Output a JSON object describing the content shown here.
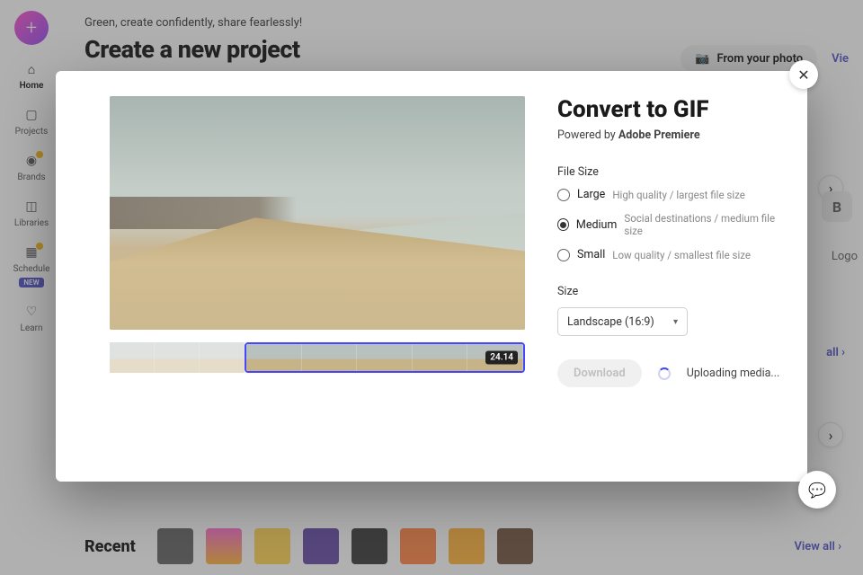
{
  "page": {
    "greeting": "Green, create confidently, share fearlessly!",
    "heading": "Create a new project",
    "from_photo": "From your photo",
    "view_link": "Vie",
    "logo_label": "Logo",
    "viewall": "all  ›",
    "recent_label": "Recent",
    "viewall_full": "View all  ›"
  },
  "sidebar": {
    "items": [
      {
        "label": "Home"
      },
      {
        "label": "Projects"
      },
      {
        "label": "Brands"
      },
      {
        "label": "Libraries"
      },
      {
        "label": "Schedule"
      },
      {
        "label": "Learn"
      }
    ],
    "new_badge": "NEW"
  },
  "modal": {
    "title": "Convert to GIF",
    "powered_prefix": "Powered by ",
    "powered_brand": "Adobe Premiere",
    "filesize_label": "File Size",
    "options": [
      {
        "name": "Large",
        "desc": "High quality / largest file size",
        "selected": false
      },
      {
        "name": "Medium",
        "desc": "Social destinations / medium file size",
        "selected": true
      },
      {
        "name": "Small",
        "desc": "Low quality / smallest file size",
        "selected": false
      }
    ],
    "size_label": "Size",
    "size_value": "Landscape (16:9)",
    "download_label": "Download",
    "status_text": "Uploading media...",
    "clip_time": "24.14"
  },
  "thumbs_bg": [
    "#5a5a5a",
    "#ff9900",
    "#ffd24a",
    "#5b3fa0",
    "#2d2d2d",
    "#ff7e3a",
    "#ffb02e",
    "#6b4a33"
  ]
}
